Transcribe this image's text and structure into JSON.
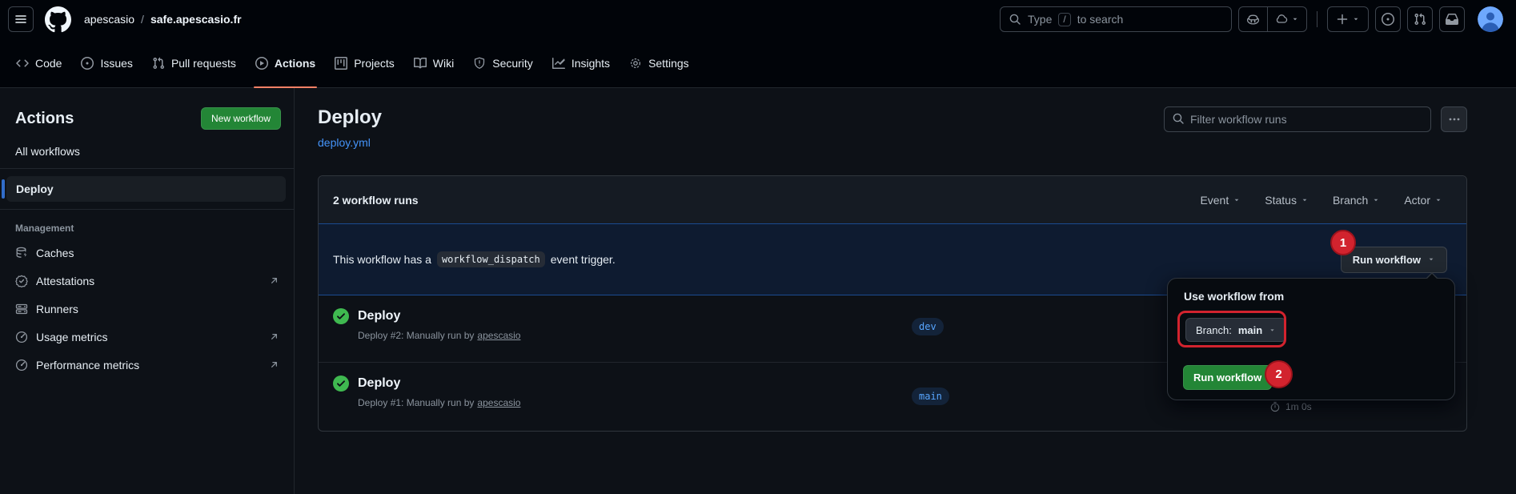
{
  "colors": {
    "accent_green": "#238636",
    "annotation_red": "#d2232e",
    "link_blue": "#4493f8",
    "branch_badge_blue": "#58a6ff",
    "success_green": "#3fb950",
    "active_tab_underline": "#f78166"
  },
  "header": {
    "owner": "apescasio",
    "separator": "/",
    "repo": "safe.apescasio.fr",
    "search_prefix": "Type",
    "search_key": "/",
    "search_suffix": "to search"
  },
  "nav": {
    "tabs": [
      {
        "label": "Code"
      },
      {
        "label": "Issues"
      },
      {
        "label": "Pull requests"
      },
      {
        "label": "Actions"
      },
      {
        "label": "Projects"
      },
      {
        "label": "Wiki"
      },
      {
        "label": "Security"
      },
      {
        "label": "Insights"
      },
      {
        "label": "Settings"
      }
    ]
  },
  "sidebar": {
    "title": "Actions",
    "new_workflow": "New workflow",
    "all_workflows": "All workflows",
    "selected_workflow": "Deploy",
    "section_label": "Management",
    "items": [
      {
        "label": "Caches"
      },
      {
        "label": "Attestations"
      },
      {
        "label": "Runners"
      },
      {
        "label": "Usage metrics"
      },
      {
        "label": "Performance metrics"
      }
    ]
  },
  "main": {
    "title": "Deploy",
    "file_link": "deploy.yml",
    "filter_placeholder": "Filter workflow runs",
    "table": {
      "count_label": "2 workflow runs",
      "filters": [
        {
          "label": "Event"
        },
        {
          "label": "Status"
        },
        {
          "label": "Branch"
        },
        {
          "label": "Actor"
        }
      ],
      "banner": {
        "text_before": "This workflow has a",
        "code": "workflow_dispatch",
        "text_after": "event trigger.",
        "button": "Run workflow"
      },
      "rows": [
        {
          "status": "success",
          "title": "Deploy",
          "run_text": "Deploy #2: Manually run by",
          "actor": "apescasio",
          "branch": "dev"
        },
        {
          "status": "success",
          "title": "Deploy",
          "run_text": "Deploy #1: Manually run by",
          "actor": "apescasio",
          "branch": "main",
          "duration": "1m 0s"
        }
      ]
    }
  },
  "dropdown": {
    "heading": "Use workflow from",
    "branch_prefix": "Branch:",
    "branch_value": "main",
    "run_button": "Run workflow"
  },
  "annotations": {
    "step1": "1",
    "step2": "2"
  }
}
